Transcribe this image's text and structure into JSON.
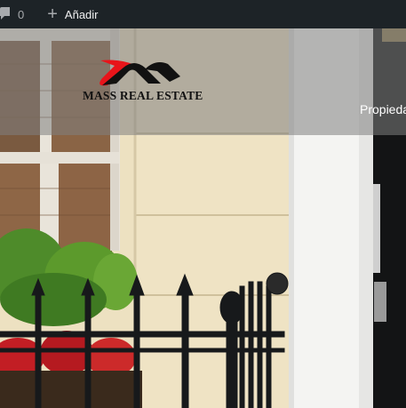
{
  "admin_bar": {
    "comments_icon": "comment-bubble-icon",
    "comments_count": "0",
    "new_icon": "plus-icon",
    "new_label": "Añadir"
  },
  "header": {
    "logo_text": "MASS REAL ESTATE",
    "nav": [
      {
        "label": "Propieda"
      }
    ]
  },
  "colors": {
    "admin_bar_bg": "#1d2327",
    "logo_red": "#e8141a",
    "logo_black": "#111111",
    "header_overlay": "rgba(128,128,128,0.55)"
  }
}
